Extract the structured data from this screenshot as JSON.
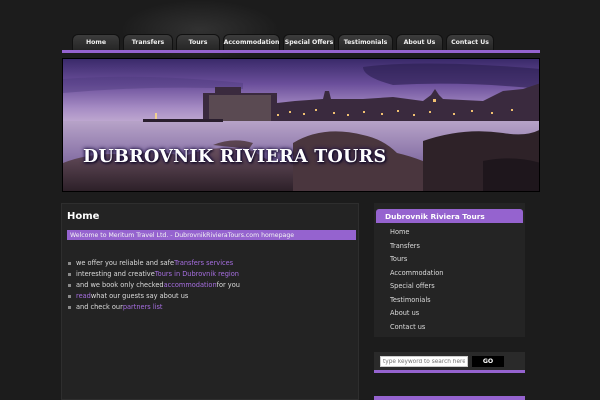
{
  "nav": {
    "items": [
      {
        "label": "Home",
        "width": 48
      },
      {
        "label": "Transfers",
        "width": 50
      },
      {
        "label": "Tours",
        "width": 44
      },
      {
        "label": "Accommodation",
        "width": 57
      },
      {
        "label": "Special Offers",
        "width": 52
      },
      {
        "label": "Testimonials",
        "width": 55
      },
      {
        "label": "About Us",
        "width": 47
      },
      {
        "label": "Contact Us",
        "width": 48
      }
    ]
  },
  "banner": {
    "title": "DUBROVNIK RIVIERA TOURS"
  },
  "main": {
    "title": "Home",
    "welcome": "Welcome to Meritum Travel Ltd. - DubrovnikRivieraTours.com homepage",
    "bullets": [
      {
        "before": "we offer  you reliable and safe ",
        "link": "Transfers services",
        "after": ""
      },
      {
        "before": "interesting and creative ",
        "link": "Tours in Dubrovnik region",
        "after": ""
      },
      {
        "before": "and we book only checked ",
        "link": "accommodation",
        "after": " for you"
      },
      {
        "before": "",
        "link": "read",
        "after": " what our guests say about us"
      },
      {
        "before": "and check our ",
        "link": "partners list",
        "after": ""
      }
    ]
  },
  "sidebar": {
    "title": "Dubrovnik Riviera Tours",
    "items": [
      "Home",
      "Transfers",
      "Tours",
      "Accommodation",
      "Special offers",
      "Testimonials",
      "About us",
      "Contact us"
    ]
  },
  "search": {
    "placeholder": "type keyword to search here",
    "button": "GO"
  },
  "colors": {
    "accent": "#9563cf",
    "link": "#a66ee0",
    "background": "#1c1c1c"
  }
}
